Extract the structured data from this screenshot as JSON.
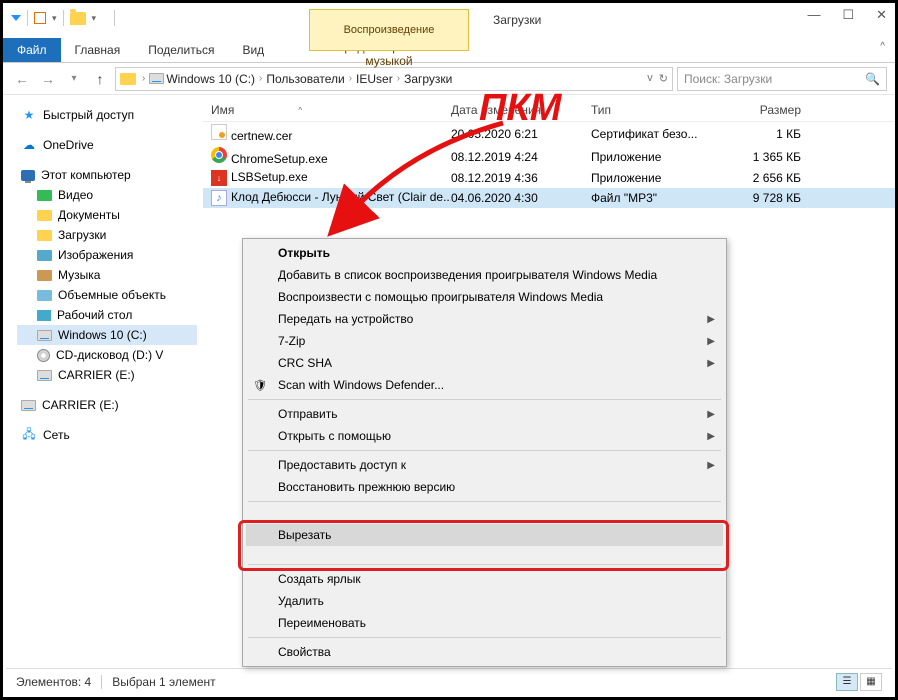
{
  "window": {
    "title": "Загрузки",
    "playback_tab": "Воспроизведение",
    "music_tools": "Средства работы с музыкой"
  },
  "ribbon": {
    "file": "Файл",
    "home": "Главная",
    "share": "Поделиться",
    "view": "Вид"
  },
  "breadcrumb": {
    "root": "Windows 10 (C:)",
    "users": "Пользователи",
    "ieuser": "IEUser",
    "downloads": "Загрузки"
  },
  "search": {
    "placeholder": "Поиск: Загрузки"
  },
  "sidebar": {
    "quick": "Быстрый доступ",
    "onedrive": "OneDrive",
    "thispc": "Этот компьютер",
    "video": "Видео",
    "documents": "Документы",
    "downloads": "Загрузки",
    "pictures": "Изображения",
    "music": "Музыка",
    "objects3d": "Объемные объекть",
    "desktop": "Рабочий стол",
    "cdrive": "Windows 10 (C:)",
    "dvd": "CD-дисковод (D:) V",
    "carrier1": "CARRIER (E:)",
    "carrier2": "CARRIER (E:)",
    "network": "Сеть"
  },
  "columns": {
    "name": "Имя",
    "date": "Дата изменения",
    "type": "Тип",
    "size": "Размер"
  },
  "files": [
    {
      "name": "certnew.cer",
      "date": "20.05.2020 6:21",
      "type": "Сертификат безо...",
      "size": "1 КБ"
    },
    {
      "name": "ChromeSetup.exe",
      "date": "08.12.2019 4:24",
      "type": "Приложение",
      "size": "1 365 КБ"
    },
    {
      "name": "LSBSetup.exe",
      "date": "08.12.2019 4:36",
      "type": "Приложение",
      "size": "2 656 КБ"
    },
    {
      "name": "Клод Дебюсси - Лунный Свет (Clair de...",
      "date": "04.06.2020 4:30",
      "type": "Файл \"MP3\"",
      "size": "9 728 КБ"
    }
  ],
  "context_menu": {
    "open": "Открыть",
    "add_wmp": "Добавить в список воспроизведения проигрывателя Windows Media",
    "play_wmp": "Воспроизвести с помощью проигрывателя Windows Media",
    "cast": "Передать на устройство",
    "7zip": "7-Zip",
    "crcsha": "CRC SHA",
    "defender": "Scan with Windows Defender...",
    "send_to": "Отправить",
    "open_with": "Открыть с помощью",
    "give_access": "Предоставить доступ к",
    "restore": "Восстановить прежнюю версию",
    "cut": "Вырезать",
    "shortcut": "Создать ярлык",
    "delete": "Удалить",
    "rename": "Переименовать",
    "properties": "Свойства"
  },
  "status": {
    "count": "Элементов: 4",
    "selected": "Выбран 1 элемент"
  },
  "annotation": {
    "pkm": "ПКМ"
  }
}
